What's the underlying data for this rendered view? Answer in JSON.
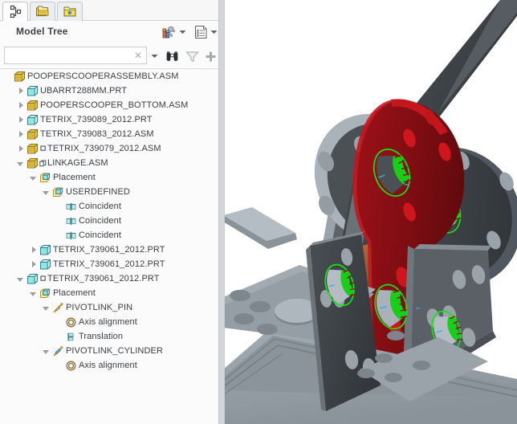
{
  "window": {
    "panel_title": "Model Tree"
  },
  "tabs": [
    {
      "name": "model-tree-tab",
      "icon": "tree-hierarchy-icon",
      "selected": true
    },
    {
      "name": "folder-browser-tab",
      "icon": "folders-icon",
      "selected": false
    },
    {
      "name": "favorites-tab",
      "icon": "folder-star-icon",
      "selected": false
    }
  ],
  "header_buttons": [
    {
      "name": "settings-button",
      "icon": "tools-settings-icon",
      "label": ""
    },
    {
      "name": "settings-dropdown",
      "icon": "chevron-down-icon",
      "label": ""
    },
    {
      "name": "display-button",
      "icon": "list-document-icon",
      "label": ""
    },
    {
      "name": "display-dropdown",
      "icon": "chevron-down-icon",
      "label": ""
    }
  ],
  "search": {
    "value": "",
    "placeholder": "",
    "clear_glyph": "✕",
    "buttons": [
      {
        "name": "search-history-dropdown",
        "icon": "chevron-down-icon"
      },
      {
        "name": "find-button",
        "icon": "binoculars-icon"
      },
      {
        "name": "filter-button",
        "icon": "funnel-icon"
      },
      {
        "name": "add-button",
        "icon": "plus-icon"
      }
    ]
  },
  "colors": {
    "panel_bg": "#fbfbfb",
    "tab_selected": "#fdfdfd",
    "tab_unselected": "#eceff1",
    "text": "#3b4045",
    "title_text": "#3f4448",
    "divider": "#d2d6da",
    "asm_icon_fill": "#ffe77a",
    "prt_icon_fill": "#8ee8e8",
    "highlight_green": "#14e614",
    "link_red": "#8c0f14",
    "metal_gray": "#9aa2ab",
    "dark_gray": "#3c4044",
    "copper": "#9c5a33"
  },
  "tree": [
    {
      "indent": 0,
      "twisty": "none",
      "icon": "assembly-icon",
      "badge": "",
      "label": "POOPERSCOOPERASSEMBLY.ASM",
      "name": "tree-item-pooperscooperassembly"
    },
    {
      "indent": 1,
      "twisty": "collapsed",
      "icon": "part-icon",
      "badge": "",
      "label": "UBARRT288MM.PRT",
      "name": "tree-item-ubarrt288mm"
    },
    {
      "indent": 1,
      "twisty": "collapsed",
      "icon": "assembly-icon",
      "badge": "",
      "label": "POOPERSCOOPER_BOTTOM.ASM",
      "name": "tree-item-pooperscooper-bottom"
    },
    {
      "indent": 1,
      "twisty": "collapsed",
      "icon": "part-icon",
      "badge": "",
      "label": "TETRIX_739089_2012.PRT",
      "name": "tree-item-tetrix-739089"
    },
    {
      "indent": 1,
      "twisty": "collapsed",
      "icon": "assembly-icon",
      "badge": "",
      "label": "TETRIX_739083_2012.ASM",
      "name": "tree-item-tetrix-739083"
    },
    {
      "indent": 1,
      "twisty": "collapsed",
      "icon": "assembly-icon",
      "badge": "square",
      "label": "TETRIX_739079_2012.ASM",
      "name": "tree-item-tetrix-739079"
    },
    {
      "indent": 1,
      "twisty": "expanded",
      "icon": "assembly-icon",
      "badge": "copy",
      "label": "LINKAGE.ASM",
      "name": "tree-item-linkage"
    },
    {
      "indent": 2,
      "twisty": "expanded",
      "icon": "placement-icon",
      "badge": "",
      "label": "Placement",
      "name": "tree-item-placement-linkage"
    },
    {
      "indent": 3,
      "twisty": "expanded",
      "icon": "placement-icon",
      "badge": "",
      "label": "USERDEFINED",
      "name": "tree-item-userdefined"
    },
    {
      "indent": 4,
      "twisty": "none",
      "icon": "coincident-icon",
      "badge": "",
      "label": "Coincident",
      "name": "tree-item-coincident-1"
    },
    {
      "indent": 4,
      "twisty": "none",
      "icon": "coincident-icon",
      "badge": "",
      "label": "Coincident",
      "name": "tree-item-coincident-2"
    },
    {
      "indent": 4,
      "twisty": "none",
      "icon": "coincident-icon",
      "badge": "",
      "label": "Coincident",
      "name": "tree-item-coincident-3"
    },
    {
      "indent": 2,
      "twisty": "collapsed",
      "icon": "part-icon",
      "badge": "",
      "label": "TETRIX_739061_2012.PRT",
      "name": "tree-item-tetrix-739061-a"
    },
    {
      "indent": 2,
      "twisty": "collapsed",
      "icon": "part-icon",
      "badge": "",
      "label": "TETRIX_739061_2012.PRT",
      "name": "tree-item-tetrix-739061-b"
    },
    {
      "indent": 1,
      "twisty": "expanded",
      "icon": "part-icon",
      "badge": "square",
      "label": "TETRIX_739061_2012.PRT",
      "name": "tree-item-tetrix-739061-c"
    },
    {
      "indent": 2,
      "twisty": "expanded",
      "icon": "placement-icon",
      "badge": "",
      "label": "Placement",
      "name": "tree-item-placement-pivot"
    },
    {
      "indent": 3,
      "twisty": "expanded",
      "icon": "pin-gold-icon",
      "badge": "",
      "label": "PIVOTLINK_PIN",
      "name": "tree-item-pivotlink-pin"
    },
    {
      "indent": 4,
      "twisty": "none",
      "icon": "axis-align-icon",
      "badge": "",
      "label": "Axis alignment",
      "name": "tree-item-axis-alignment-1"
    },
    {
      "indent": 4,
      "twisty": "none",
      "icon": "translation-icon",
      "badge": "",
      "label": "Translation",
      "name": "tree-item-translation"
    },
    {
      "indent": 3,
      "twisty": "expanded",
      "icon": "pin-blue-icon",
      "badge": "",
      "label": "PIVOTLINK_CYLINDER",
      "name": "tree-item-pivotlink-cylinder"
    },
    {
      "indent": 4,
      "twisty": "none",
      "icon": "axis-align-icon",
      "badge": "",
      "label": "Axis alignment",
      "name": "tree-item-axis-alignment-2"
    }
  ],
  "viewport": {
    "name": "cad-3d-viewport",
    "description": "3D CAD assembly view: red pivot link plate between gray metal brackets with green highlighted bore surfaces and a copper pin"
  }
}
